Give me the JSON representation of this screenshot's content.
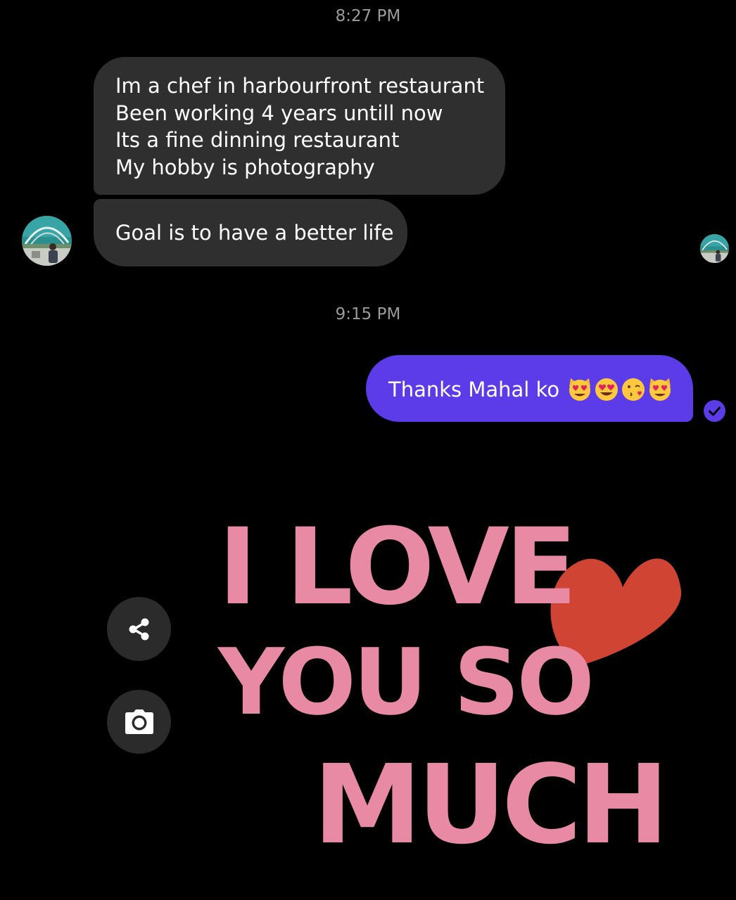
{
  "conversation": {
    "timestamps": [
      "8:27 PM",
      "9:15 PM"
    ],
    "incoming": {
      "bubble1_lines": [
        "Im a chef in  harbourfront restaurant",
        "Been working 4 years untill now",
        "Its a fine dinning restaurant",
        "My hobby is photography"
      ],
      "bubble2": "Goal is to have a better life"
    },
    "outgoing": {
      "text": "Thanks Mahal ko",
      "emojis": [
        "smiling-cat-heart-eyes",
        "smiling-face-heart-eyes",
        "face-blowing-kiss",
        "smiling-cat-heart-eyes"
      ],
      "status": "sent-check-icon"
    },
    "sticker": {
      "lines": [
        "I LOVE",
        "YOU SO",
        "MUCH"
      ],
      "text_color": "#e88aa3",
      "heart_color": "#d04434"
    }
  },
  "actions": {
    "share_icon": "share-icon",
    "camera_icon": "camera-icon"
  },
  "colors": {
    "background": "#000000",
    "incoming_bubble": "#2f2f2f",
    "outgoing_bubble": "#5b3ce8",
    "timestamp": "#9a9a9a"
  }
}
